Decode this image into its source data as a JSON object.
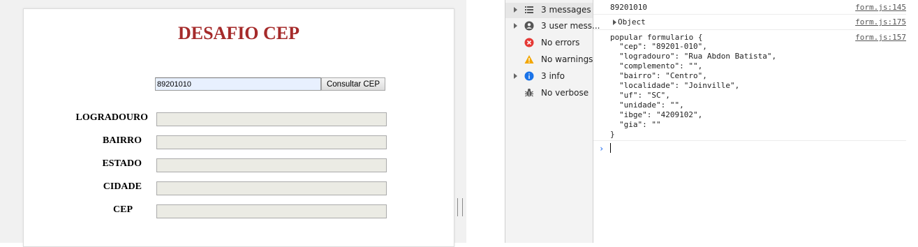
{
  "form": {
    "title": "DESAFIO CEP",
    "cep_value": "89201010",
    "consult_button": "Consultar CEP",
    "fields": [
      {
        "label": "LOGRADOURO"
      },
      {
        "label": "BAIRRO"
      },
      {
        "label": "ESTADO"
      },
      {
        "label": "CIDADE"
      },
      {
        "label": "CEP"
      }
    ]
  },
  "devtools": {
    "sidebar": [
      {
        "label": "3 messages",
        "icon": "list-icon",
        "selected": true
      },
      {
        "label": "3 user mess...",
        "icon": "user-icon"
      },
      {
        "label": "No errors",
        "icon": "error-icon"
      },
      {
        "label": "No warnings",
        "icon": "warning-icon"
      },
      {
        "label": "3 info",
        "icon": "info-icon"
      },
      {
        "label": "No verbose",
        "icon": "bug-icon"
      }
    ],
    "console": {
      "messages": [
        {
          "text": "89201010",
          "source": "form.js:145"
        },
        {
          "text": "Object",
          "source": "form.js:175"
        },
        {
          "text": "popular formulario {",
          "source": "form.js:157"
        }
      ],
      "object_lines": [
        "\"cep\": \"89201-010\",",
        "\"logradouro\": \"Rua Abdon Batista\",",
        "\"complemento\": \"\",",
        "\"bairro\": \"Centro\",",
        "\"localidade\": \"Joinville\",",
        "\"uf\": \"SC\",",
        "\"unidade\": \"\",",
        "\"ibge\": \"4209102\",",
        "\"gia\": \"\""
      ],
      "closing": "}"
    }
  },
  "colors": {
    "title": "#a52a2a",
    "autofill": "#e8f0fe",
    "error": "#e53935",
    "warning": "#f2a600",
    "info": "#1a73e8",
    "prompt": "#367cf1"
  }
}
